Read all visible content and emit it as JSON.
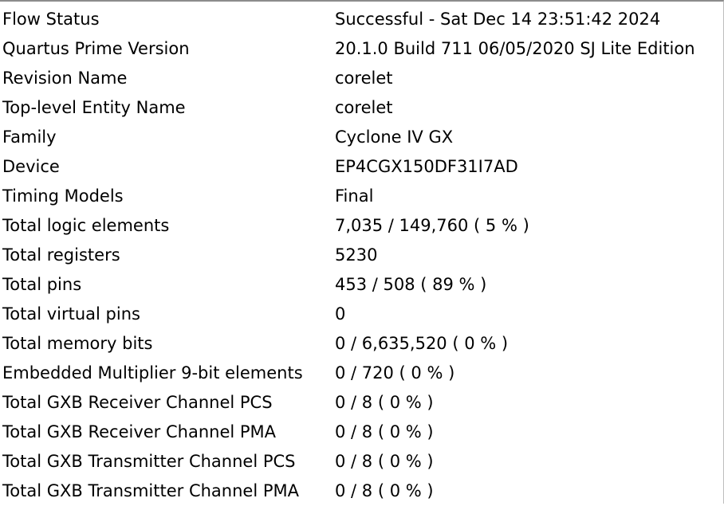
{
  "report": {
    "rows": [
      {
        "name": "Flow Status",
        "value": "Successful - Sat Dec 14 23:51:42 2024"
      },
      {
        "name": "Quartus Prime Version",
        "value": "20.1.0 Build 711 06/05/2020 SJ Lite Edition"
      },
      {
        "name": "Revision Name",
        "value": "corelet"
      },
      {
        "name": "Top-level Entity Name",
        "value": "corelet"
      },
      {
        "name": "Family",
        "value": "Cyclone IV GX"
      },
      {
        "name": "Device",
        "value": "EP4CGX150DF31I7AD"
      },
      {
        "name": "Timing Models",
        "value": "Final"
      },
      {
        "name": "Total logic elements",
        "value": "7,035 / 149,760 ( 5 % )"
      },
      {
        "name": "Total registers",
        "value": "5230"
      },
      {
        "name": "Total pins",
        "value": "453 / 508 ( 89 % )"
      },
      {
        "name": "Total virtual pins",
        "value": "0"
      },
      {
        "name": "Total memory bits",
        "value": "0 / 6,635,520 ( 0 % )"
      },
      {
        "name": "Embedded Multiplier 9-bit elements",
        "value": "0 / 720 ( 0 % )"
      },
      {
        "name": "Total GXB Receiver Channel PCS",
        "value": "0 / 8 ( 0 % )"
      },
      {
        "name": "Total GXB Receiver Channel PMA",
        "value": "0 / 8 ( 0 % )"
      },
      {
        "name": "Total GXB Transmitter Channel PCS",
        "value": "0 / 8 ( 0 % )"
      },
      {
        "name": "Total GXB Transmitter Channel PMA",
        "value": "0 / 8 ( 0 % )"
      }
    ]
  }
}
